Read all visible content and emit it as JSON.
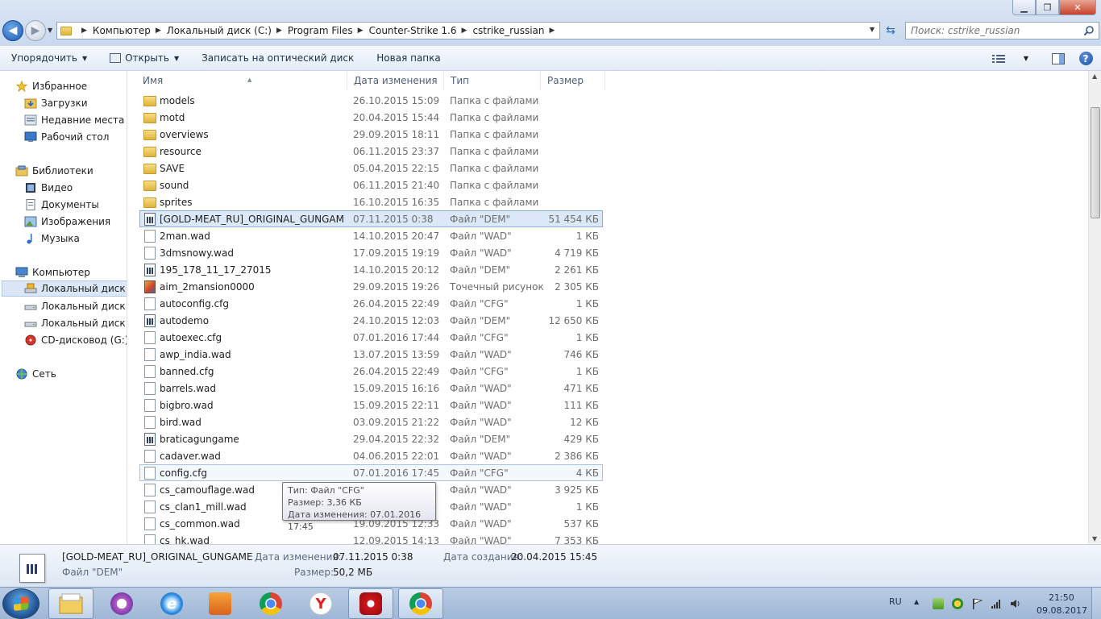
{
  "window": {
    "minimize": "▁",
    "maximize": "❐",
    "close": "✕"
  },
  "address": {
    "breadcrumbs": [
      "Компьютер",
      "Локальный диск (C:)",
      "Program Files",
      "Counter-Strike 1.6",
      "cstrike_russian"
    ]
  },
  "search": {
    "placeholder": "Поиск: cstrike_russian"
  },
  "toolbar": {
    "organize": "Упорядочить",
    "open": "Открыть",
    "burn": "Записать на оптический диск",
    "new_folder": "Новая папка"
  },
  "nav": {
    "favorites": "Избранное",
    "downloads": "Загрузки",
    "recent": "Недавние места",
    "desktop": "Рабочий стол",
    "libraries": "Библиотеки",
    "video": "Видео",
    "documents": "Документы",
    "images": "Изображения",
    "music": "Музыка",
    "computer": "Компьютер",
    "disk_c": "Локальный диск (C",
    "disk_d": "Локальный диск (D",
    "disk_e": "Локальный диск (E:",
    "cd_drive": "CD-дисковод (G:) C",
    "network": "Сеть"
  },
  "columns": {
    "name": "Имя",
    "date": "Дата изменения",
    "type": "Тип",
    "size": "Размер"
  },
  "files": [
    {
      "name": "models",
      "date": "26.10.2015 15:09",
      "type": "Папка с файлами",
      "size": "",
      "icon": "folder"
    },
    {
      "name": "motd",
      "date": "20.04.2015 15:44",
      "type": "Папка с файлами",
      "size": "",
      "icon": "folder"
    },
    {
      "name": "overviews",
      "date": "29.09.2015 18:11",
      "type": "Папка с файлами",
      "size": "",
      "icon": "folder"
    },
    {
      "name": "resource",
      "date": "06.11.2015 23:37",
      "type": "Папка с файлами",
      "size": "",
      "icon": "folder"
    },
    {
      "name": "SAVE",
      "date": "05.04.2015 22:15",
      "type": "Папка с файлами",
      "size": "",
      "icon": "folder"
    },
    {
      "name": "sound",
      "date": "06.11.2015 21:40",
      "type": "Папка с файлами",
      "size": "",
      "icon": "folder"
    },
    {
      "name": "sprites",
      "date": "16.10.2015 16:35",
      "type": "Папка с файлами",
      "size": "",
      "icon": "folder"
    },
    {
      "name": "[GOLD-MEAT_RU]_ORIGINAL_GUNGAME",
      "date": "07.11.2015 0:38",
      "type": "Файл \"DEM\"",
      "size": "51 454 КБ",
      "icon": "dem",
      "state": "selected"
    },
    {
      "name": "2man.wad",
      "date": "14.10.2015 20:47",
      "type": "Файл \"WAD\"",
      "size": "1 КБ",
      "icon": "file"
    },
    {
      "name": "3dmsnowy.wad",
      "date": "17.09.2015 19:19",
      "type": "Файл \"WAD\"",
      "size": "4 719 КБ",
      "icon": "file"
    },
    {
      "name": "195_178_11_17_27015",
      "date": "14.10.2015 20:12",
      "type": "Файл \"DEM\"",
      "size": "2 261 КБ",
      "icon": "dem"
    },
    {
      "name": "aim_2mansion0000",
      "date": "29.09.2015 19:26",
      "type": "Точечный рисунок",
      "size": "2 305 КБ",
      "icon": "bmp"
    },
    {
      "name": "autoconfig.cfg",
      "date": "26.04.2015 22:49",
      "type": "Файл \"CFG\"",
      "size": "1 КБ",
      "icon": "file"
    },
    {
      "name": "autodemo",
      "date": "24.10.2015 12:03",
      "type": "Файл \"DEM\"",
      "size": "12 650 КБ",
      "icon": "dem"
    },
    {
      "name": "autoexec.cfg",
      "date": "07.01.2016 17:44",
      "type": "Файл \"CFG\"",
      "size": "1 КБ",
      "icon": "file"
    },
    {
      "name": "awp_india.wad",
      "date": "13.07.2015 13:59",
      "type": "Файл \"WAD\"",
      "size": "746 КБ",
      "icon": "file"
    },
    {
      "name": "banned.cfg",
      "date": "26.04.2015 22:49",
      "type": "Файл \"CFG\"",
      "size": "1 КБ",
      "icon": "file"
    },
    {
      "name": "barrels.wad",
      "date": "15.09.2015 16:16",
      "type": "Файл \"WAD\"",
      "size": "471 КБ",
      "icon": "file"
    },
    {
      "name": "bigbro.wad",
      "date": "15.09.2015 22:11",
      "type": "Файл \"WAD\"",
      "size": "111 КБ",
      "icon": "file"
    },
    {
      "name": "bird.wad",
      "date": "03.09.2015 21:22",
      "type": "Файл \"WAD\"",
      "size": "12 КБ",
      "icon": "file"
    },
    {
      "name": "braticagungame",
      "date": "29.04.2015 22:32",
      "type": "Файл \"DEM\"",
      "size": "429 КБ",
      "icon": "dem"
    },
    {
      "name": "cadaver.wad",
      "date": "04.06.2015 22:01",
      "type": "Файл \"WAD\"",
      "size": "2 386 КБ",
      "icon": "file"
    },
    {
      "name": "config.cfg",
      "date": "07.01.2016 17:45",
      "type": "Файл \"CFG\"",
      "size": "4 КБ",
      "icon": "file",
      "state": "hover"
    },
    {
      "name": "cs_camouflage.wad",
      "date": "",
      "type": "Файл \"WAD\"",
      "size": "3 925 КБ",
      "icon": "file"
    },
    {
      "name": "cs_clan1_mill.wad",
      "date": "",
      "type": "Файл \"WAD\"",
      "size": "1 КБ",
      "icon": "file"
    },
    {
      "name": "cs_common.wad",
      "date": "19.09.2015 12:33",
      "type": "Файл \"WAD\"",
      "size": "537 КБ",
      "icon": "file"
    },
    {
      "name": "cs_hk.wad",
      "date": "12.09.2015 14:13",
      "type": "Файл \"WAD\"",
      "size": "7 353 КБ",
      "icon": "file"
    }
  ],
  "tooltip": {
    "type": "Тип: Файл \"CFG\"",
    "size": "Размер: 3,36 КБ",
    "modified": "Дата изменения: 07.01.2016 17:45"
  },
  "details": {
    "name": "[GOLD-MEAT_RU]_ORIGINAL_GUNGAME",
    "type": "Файл \"DEM\"",
    "modified_label": "Дата изменения:",
    "modified_value": "07.11.2015 0:38",
    "size_label": "Размер:",
    "size_value": "50,2 МБ",
    "created_label": "Дата создания:",
    "created_value": "20.04.2015 15:45"
  },
  "taskbar": {
    "lang": "RU",
    "time": "21:50",
    "date": "09.08.2017"
  }
}
